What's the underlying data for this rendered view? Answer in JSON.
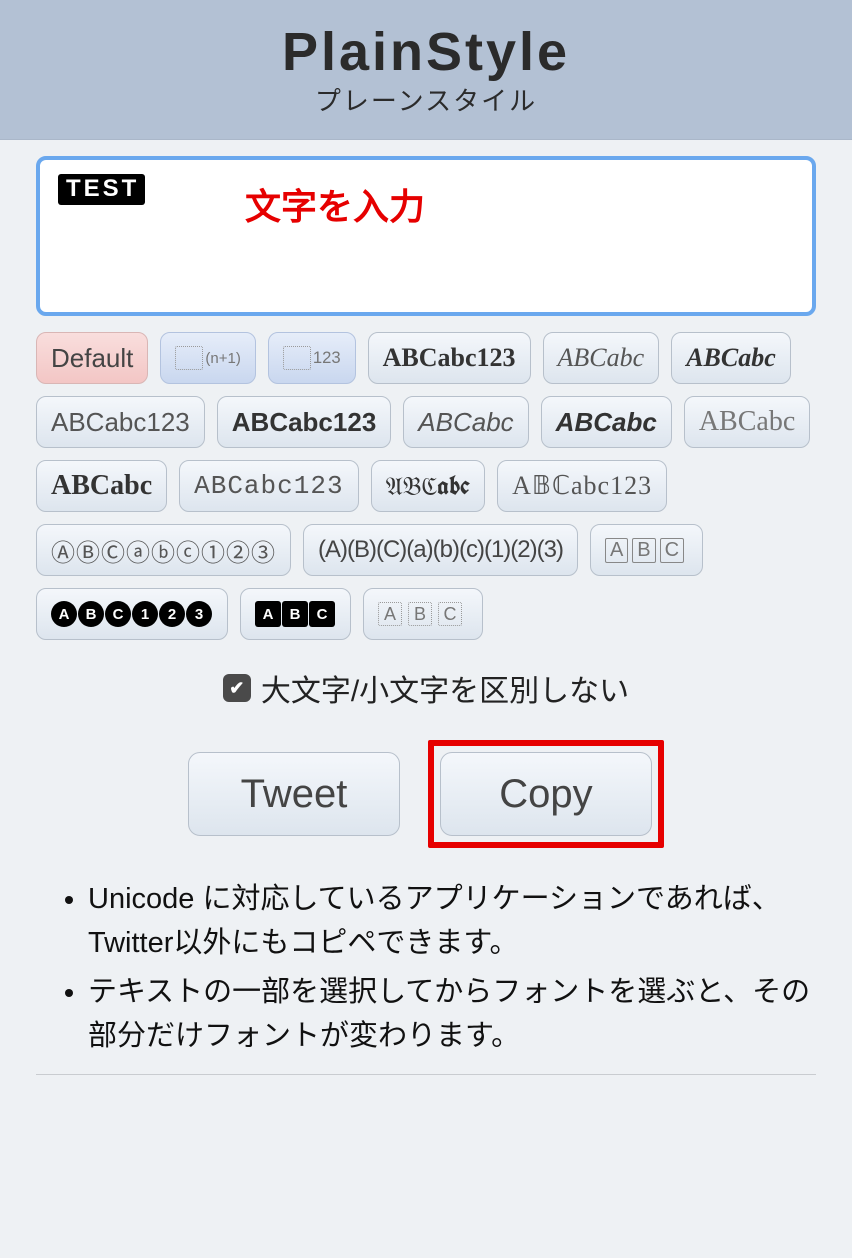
{
  "header": {
    "title": "PlainStyle",
    "subtitle": "プレーンスタイル"
  },
  "input": {
    "value": "TEST",
    "annotation": "文字を入力"
  },
  "styles": {
    "default_label": "Default",
    "np1_label": "(n+1)",
    "n123_label": "123",
    "s1": "ABCabc123",
    "s2": "ABCabc",
    "s3": "ABCabc",
    "s4": "ABCabc123",
    "s5": "ABCabc123",
    "s6": "ABCabc",
    "s7": "ABCabc",
    "s8": "ABCabc",
    "s9": "ABCabc",
    "s10": "ABCabc123",
    "s11": "𝔄𝔅ℭabc",
    "s12": "A𝔹ℂabc123",
    "circled": "ⒶⒷⒸⓐⓑⓒ①②③",
    "paren": "(A)(B)(C)(a)(b)(c)(1)(2)(3)",
    "box_a": "A",
    "box_b": "B",
    "box_c": "C",
    "bc_a": "A",
    "bc_b": "B",
    "bc_c": "C",
    "bc_1": "1",
    "bc_2": "2",
    "bc_3": "3",
    "bs_a": "A",
    "bs_b": "B",
    "bs_c": "C",
    "db_a": "A",
    "db_b": "B",
    "db_c": "C"
  },
  "checkbox": {
    "label": "大文字/小文字を区別しない"
  },
  "actions": {
    "tweet": "Tweet",
    "copy": "Copy"
  },
  "notes": {
    "n1": "Unicode に対応しているアプリケーションであれば、Twitter以外にもコピペできます。",
    "n2": "テキストの一部を選択してからフォントを選ぶと、その部分だけフォントが変わります。"
  }
}
